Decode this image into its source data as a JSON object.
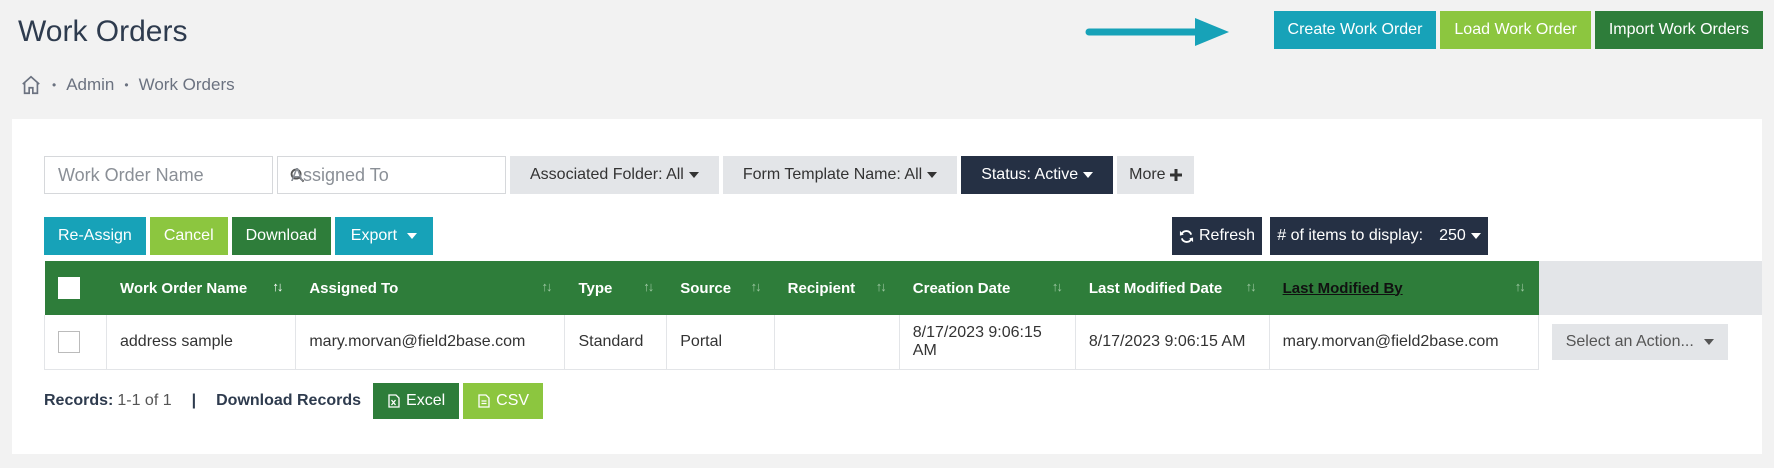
{
  "page": {
    "title": "Work Orders"
  },
  "breadcrumb": {
    "items": [
      "Admin",
      "Work Orders"
    ],
    "separator": "•"
  },
  "top_actions": {
    "create": "Create Work Order",
    "load": "Load Work Order",
    "import": "Import Work Orders"
  },
  "filters": {
    "name_placeholder": "Work Order Name",
    "assigned_placeholder": "Assigned To",
    "folder": "Associated Folder: All",
    "template": "Form Template Name: All",
    "status": "Status: Active",
    "more": "More"
  },
  "toolbar": {
    "reassign": "Re-Assign",
    "cancel": "Cancel",
    "download": "Download",
    "export": "Export",
    "refresh": "Refresh",
    "items_label": "# of items to display:",
    "items_value": "250"
  },
  "table": {
    "columns": [
      "Work Order Name",
      "Assigned To",
      "Type",
      "Source",
      "Recipient",
      "Creation Date",
      "Last Modified Date",
      "Last Modified By"
    ],
    "rows": [
      {
        "name": "address sample",
        "assigned_to": "mary.morvan@field2base.com",
        "type": "Standard",
        "source": "Portal",
        "recipient": "",
        "created": "8/17/2023 9:06:15 AM",
        "modified": "8/17/2023 9:06:15 AM",
        "modified_by": "mary.morvan@field2base.com",
        "action": "Select an Action..."
      }
    ]
  },
  "footer": {
    "records_label": "Records:",
    "records_value": "1-1 of 1",
    "divider": "|",
    "download_label": "Download Records",
    "excel": "Excel",
    "csv": "CSV"
  },
  "colors": {
    "teal": "#17a2b8",
    "lime": "#8cc63f",
    "green": "#2e7d3a",
    "navy": "#253044"
  }
}
